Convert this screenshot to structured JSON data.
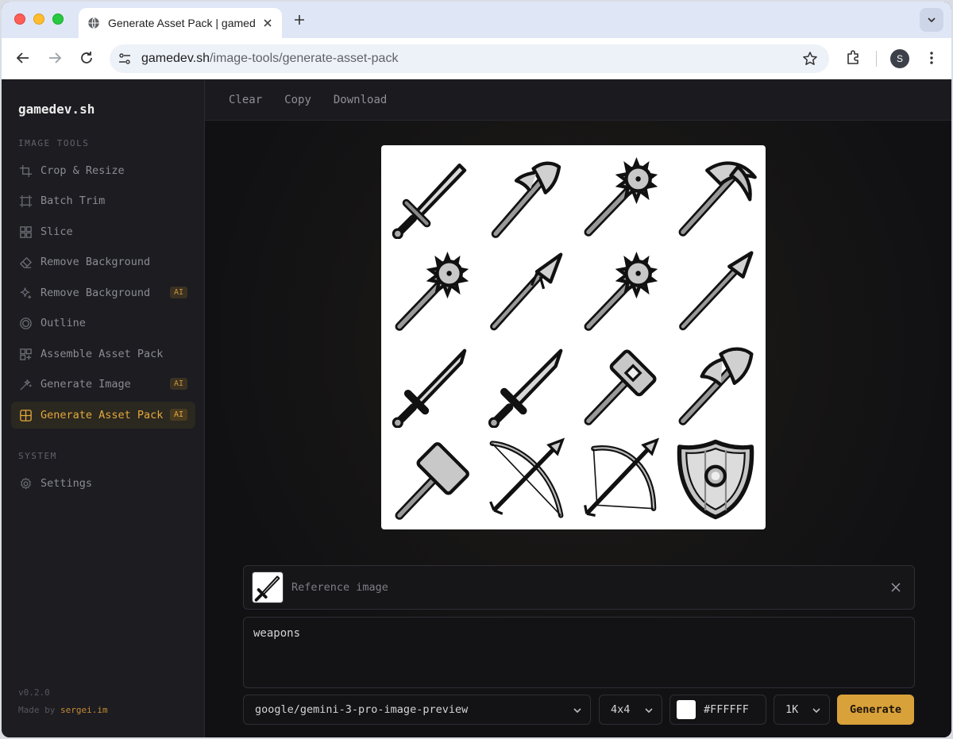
{
  "browser": {
    "tab_title": "Generate Asset Pack | gamedev.sh",
    "url_domain": "gamedev.sh",
    "url_path": "/image-tools/generate-asset-pack",
    "profile_initial": "S"
  },
  "sidebar": {
    "brand": "gamedev.sh",
    "section_tools": "IMAGE TOOLS",
    "items": [
      {
        "label": "Crop & Resize",
        "icon": "crop-icon",
        "ai": ""
      },
      {
        "label": "Batch Trim",
        "icon": "trim-icon",
        "ai": ""
      },
      {
        "label": "Slice",
        "icon": "grid-icon",
        "ai": ""
      },
      {
        "label": "Remove Background",
        "icon": "eraser-icon",
        "ai": ""
      },
      {
        "label": "Remove Background",
        "icon": "sparkle-icon",
        "ai": "AI"
      },
      {
        "label": "Outline",
        "icon": "outline-icon",
        "ai": ""
      },
      {
        "label": "Assemble Asset Pack",
        "icon": "grid-plus-icon",
        "ai": ""
      },
      {
        "label": "Generate Image",
        "icon": "wand-icon",
        "ai": "AI"
      },
      {
        "label": "Generate Asset Pack",
        "icon": "layout-icon",
        "ai": "AI"
      }
    ],
    "section_system": "SYSTEM",
    "settings_label": "Settings",
    "version": "v0.2.0",
    "credit_prefix": "Made by ",
    "credit_link": "sergei.im"
  },
  "actions": {
    "clear": "Clear",
    "copy": "Copy",
    "download": "Download"
  },
  "generator": {
    "reference_label": "Reference image",
    "prompt": "weapons",
    "model": "google/gemini-3-pro-image-preview",
    "grid": "4x4",
    "background_color": "#FFFFFF",
    "resolution": "1K",
    "generate_label": "Generate"
  },
  "colors": {
    "accent": "#d9a13a",
    "active_text": "#e5a93c"
  }
}
